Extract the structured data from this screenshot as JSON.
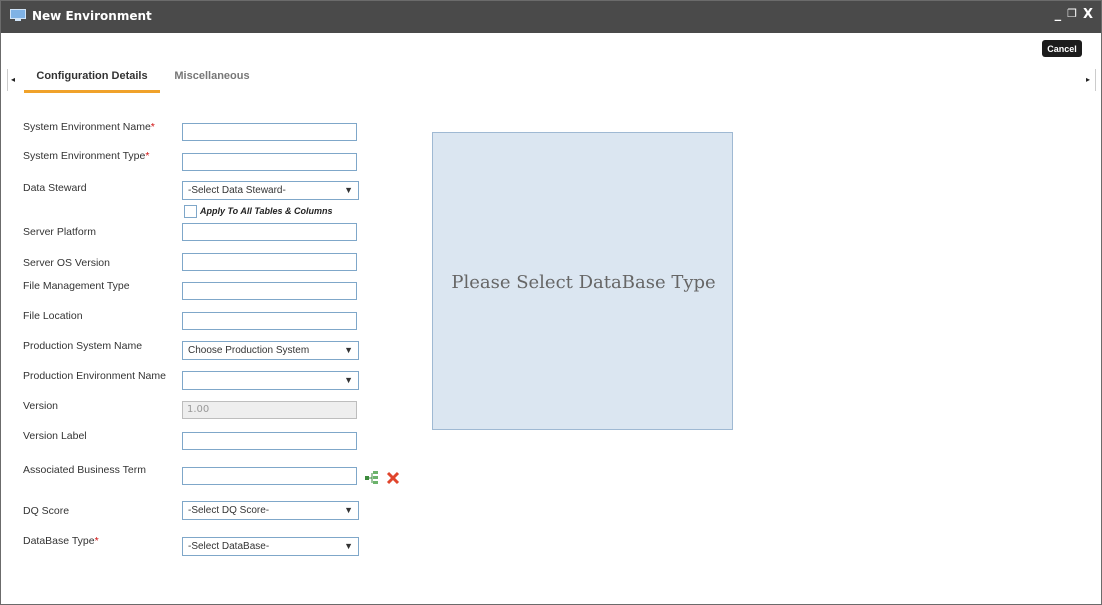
{
  "window": {
    "title": "New Environment",
    "controls": {
      "minimize": "_",
      "restore": "❐",
      "close": "X"
    }
  },
  "toolbar": {
    "cancel_label": "Cancel"
  },
  "tabs": [
    {
      "label": "Configuration Details",
      "active": true
    },
    {
      "label": "Miscellaneous",
      "active": false
    }
  ],
  "tab_nav": {
    "left": "◂",
    "right": "▸"
  },
  "form": {
    "system_environment_name": {
      "label": "System Environment Name",
      "required": "*",
      "value": ""
    },
    "system_environment_type": {
      "label": "System Environment Type",
      "required": "*",
      "value": ""
    },
    "data_steward": {
      "label": "Data Steward",
      "selected": "-Select Data Steward-"
    },
    "apply_all": {
      "label": "Apply To All Tables & Columns",
      "checked": false
    },
    "server_platform": {
      "label": "Server Platform",
      "value": ""
    },
    "server_os_version": {
      "label": "Server OS Version",
      "value": ""
    },
    "file_management_type": {
      "label": "File Management Type",
      "value": ""
    },
    "file_location": {
      "label": "File Location",
      "value": ""
    },
    "production_system_name": {
      "label": "Production System Name",
      "selected": "Choose Production System"
    },
    "production_environment_name": {
      "label": "Production Environment Name",
      "selected": ""
    },
    "version": {
      "label": "Version",
      "value": "1.00"
    },
    "version_label": {
      "label": "Version Label",
      "value": ""
    },
    "associated_business_term": {
      "label": "Associated Business Term",
      "value": ""
    },
    "dq_score": {
      "label": "DQ Score",
      "selected": "-Select DQ Score-"
    },
    "database_type": {
      "label": "DataBase Type",
      "required": "*",
      "selected": "-Select DataBase-"
    }
  },
  "caret": "▼",
  "preview_panel": {
    "message": "Please Select DataBase Type"
  },
  "icons": {
    "business_term": "tree-hierarchy-icon",
    "delete": "red-x-delete-icon"
  },
  "colors": {
    "titlebar": "#4a4a4a",
    "accent_tab": "#f0a22a",
    "panel_bg": "#dbe6f1",
    "required": "#d01010"
  }
}
